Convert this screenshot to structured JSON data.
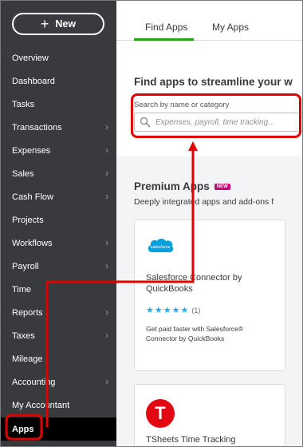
{
  "sidebar": {
    "new_button_label": "New",
    "items": [
      {
        "label": "Overview",
        "has_chevron": false
      },
      {
        "label": "Dashboard",
        "has_chevron": false
      },
      {
        "label": "Tasks",
        "has_chevron": false
      },
      {
        "label": "Transactions",
        "has_chevron": true
      },
      {
        "label": "Expenses",
        "has_chevron": true
      },
      {
        "label": "Sales",
        "has_chevron": true
      },
      {
        "label": "Cash Flow",
        "has_chevron": true
      },
      {
        "label": "Projects",
        "has_chevron": false
      },
      {
        "label": "Workflows",
        "has_chevron": true
      },
      {
        "label": "Payroll",
        "has_chevron": true
      },
      {
        "label": "Time",
        "has_chevron": false
      },
      {
        "label": "Reports",
        "has_chevron": true
      },
      {
        "label": "Taxes",
        "has_chevron": true
      },
      {
        "label": "Mileage",
        "has_chevron": false
      },
      {
        "label": "Accounting",
        "has_chevron": true
      },
      {
        "label": "My Accountant",
        "has_chevron": false
      },
      {
        "label": "Apps",
        "has_chevron": false,
        "active": true
      }
    ]
  },
  "tabs": [
    {
      "label": "Find Apps",
      "active": true
    },
    {
      "label": "My Apps",
      "active": false
    }
  ],
  "headline": "Find apps to streamline your w",
  "search": {
    "label": "Search by name or category",
    "placeholder": "Expenses, payroll, time tracking..."
  },
  "premium": {
    "title": "Premium Apps",
    "badge": "NEW",
    "subtitle": "Deeply integrated apps and add-ons f"
  },
  "cards": [
    {
      "logo_text": "salesforce",
      "title": "Salesforce Connector by QuickBooks",
      "rating_stars": 5,
      "rating_count": "(1)",
      "description": "Get paid faster with Salesforce® Connector by QuickBooks"
    },
    {
      "logo_text": "T",
      "title": "TSheets Time Tracking"
    }
  ],
  "colors": {
    "sidebar_bg": "#393a3d",
    "active_item_bg": "#000000",
    "tab_accent": "#2ca01c",
    "annotation": "#e00000",
    "star": "#21abf6",
    "badge": "#c9007a",
    "salesforce": "#00a1e0",
    "tsheets": "#e30613"
  }
}
